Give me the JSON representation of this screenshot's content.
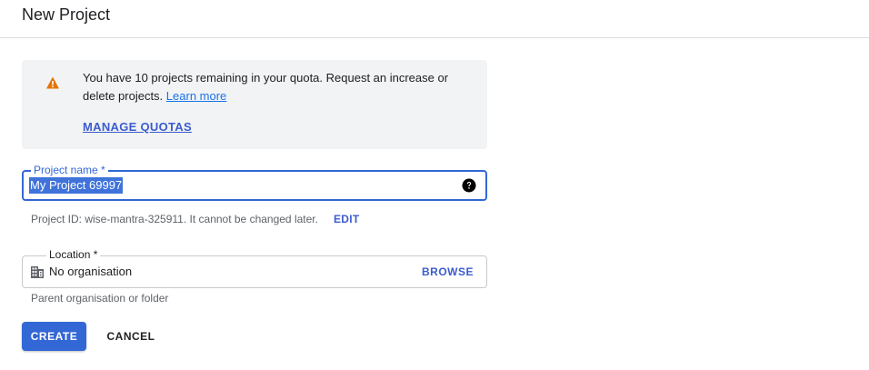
{
  "header": {
    "title": "New Project"
  },
  "notice": {
    "icon": "warning-icon",
    "icon_color": "#e37400",
    "text": "You have 10 projects remaining in your quota. Request an increase or delete projects.",
    "learn_more": "Learn more",
    "manage_quotas": "MANAGE QUOTAS"
  },
  "project_name": {
    "label": "Project name *",
    "value": "My Project 69997",
    "help_icon": "help-circle-icon"
  },
  "project_id": {
    "text": "Project ID: wise-mantra-325911. It cannot be changed later.",
    "edit": "EDIT"
  },
  "location": {
    "label": "Location *",
    "icon": "building-icon",
    "value": "No organisation",
    "browse": "BROWSE",
    "helper": "Parent organisation or folder"
  },
  "actions": {
    "create": "CREATE",
    "cancel": "CANCEL"
  },
  "colors": {
    "primary": "#3367d6",
    "link": "#1a73e8",
    "notice_bg": "#f1f3f4"
  }
}
